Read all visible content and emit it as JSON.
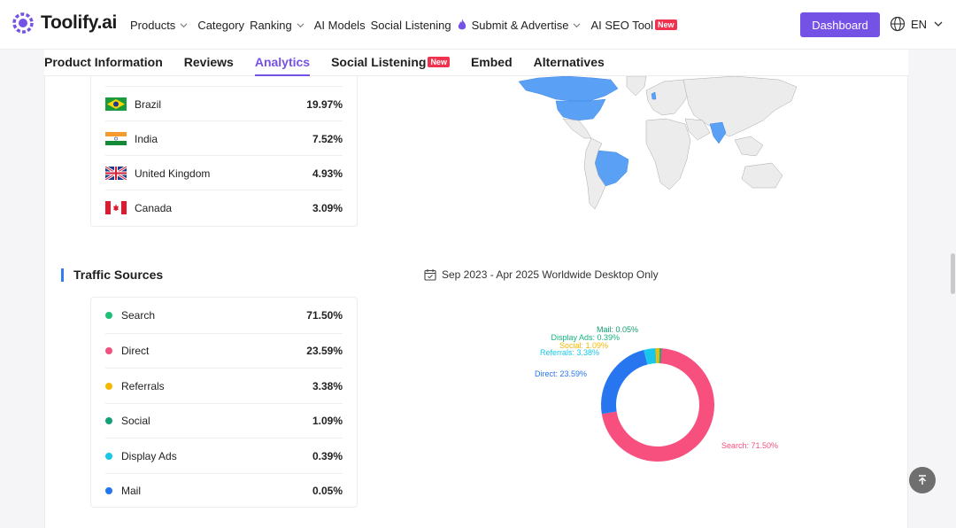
{
  "header": {
    "logo_text": "Toolify.ai",
    "nav": [
      {
        "label": "Products",
        "dropdown": true
      },
      {
        "label": "Category",
        "dropdown": false
      },
      {
        "label": "Ranking",
        "dropdown": true
      },
      {
        "label": "AI Models",
        "dropdown": false
      },
      {
        "label": "Social Listening",
        "dropdown": false
      },
      {
        "label": "Submit & Advertise",
        "dropdown": true,
        "icon": "fire-icon"
      },
      {
        "label": "AI SEO Tool",
        "badge": "New"
      }
    ],
    "dashboard_label": "Dashboard",
    "language": "EN"
  },
  "tabs": [
    {
      "label": "Product Information",
      "active": false
    },
    {
      "label": "Reviews",
      "active": false
    },
    {
      "label": "Analytics",
      "active": true
    },
    {
      "label": "Social Listening",
      "active": false,
      "badge": "New"
    },
    {
      "label": "Embed",
      "active": false
    },
    {
      "label": "Alternatives",
      "active": false
    }
  ],
  "countries": [
    {
      "name": "Brazil",
      "value": "19.97%",
      "flag": "brazil-flag-icon"
    },
    {
      "name": "India",
      "value": "7.52%",
      "flag": "india-flag-icon"
    },
    {
      "name": "United Kingdom",
      "value": "4.93%",
      "flag": "uk-flag-icon"
    },
    {
      "name": "Canada",
      "value": "3.09%",
      "flag": "canada-flag-icon"
    }
  ],
  "traffic": {
    "title": "Traffic Sources",
    "date_range": "Sep 2023 - Apr 2025 Worldwide Desktop Only",
    "sources": [
      {
        "name": "Search",
        "value": "71.50%",
        "color": "#1fbf7a"
      },
      {
        "name": "Direct",
        "value": "23.59%",
        "color": "#f0517e"
      },
      {
        "name": "Referrals",
        "value": "3.38%",
        "color": "#f5b800"
      },
      {
        "name": "Social",
        "value": "1.09%",
        "color": "#13a079"
      },
      {
        "name": "Display Ads",
        "value": "0.39%",
        "color": "#18c7ea"
      },
      {
        "name": "Mail",
        "value": "0.05%",
        "color": "#2175f2"
      }
    ]
  },
  "chart_data": {
    "type": "pie",
    "categories": [
      "Search",
      "Direct",
      "Referrals",
      "Social",
      "Display Ads",
      "Mail"
    ],
    "values": [
      71.5,
      23.59,
      3.38,
      1.09,
      0.39,
      0.05
    ],
    "labels": [
      "Search: 71.50%",
      "Direct: 23.59%",
      "Referrals: 3.38%",
      "Social: 1.09%",
      "Display Ads: 0.39%",
      "Mail: 0.05%"
    ],
    "colors": [
      "#f7507f",
      "#2875f0",
      "#18c7ea",
      "#f5b800",
      "#13b47a",
      "#0f9e6e"
    ]
  }
}
